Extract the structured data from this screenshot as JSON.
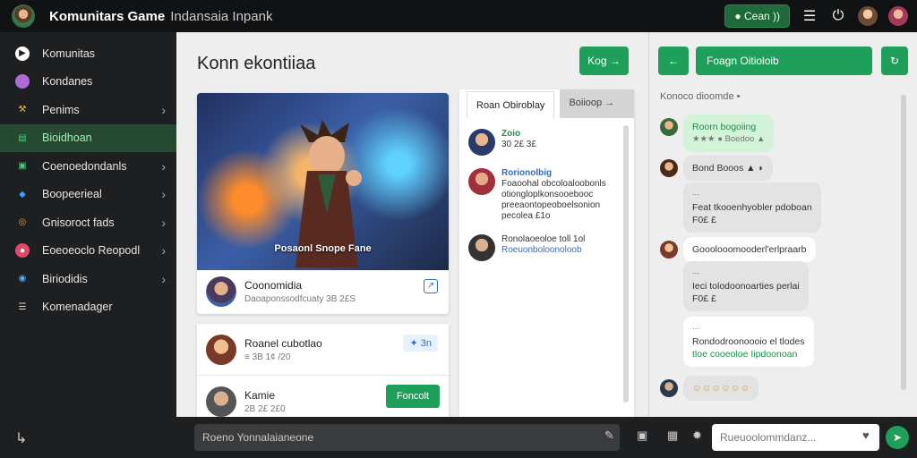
{
  "app": {
    "title": "Komunitars Game",
    "subtitle": "Indansaia Inpank"
  },
  "topbar": {
    "online_label": "● Cean )) ",
    "menu_icon": "☰",
    "power_icon": "⏻"
  },
  "sidebar": {
    "items": [
      {
        "label": "Komunitas",
        "icon": "play-icon",
        "glyph": "▶",
        "bg": "#ffffff",
        "fg": "#1e1f21",
        "chevron": false,
        "active": false
      },
      {
        "label": "Kondanes",
        "icon": "avatar-icon",
        "glyph": "",
        "bg": "#b06ad8",
        "fg": "#fff",
        "chevron": false,
        "active": false
      },
      {
        "label": "Penims",
        "icon": "trophy-icon",
        "glyph": "⚒",
        "bg": "transparent",
        "fg": "#e0c060",
        "chevron": true,
        "active": false
      },
      {
        "label": "Bioidhoan",
        "icon": "chart-icon",
        "glyph": "▤",
        "bg": "transparent",
        "fg": "#3fd07a",
        "chevron": false,
        "active": true
      },
      {
        "label": "Coenoedondanls",
        "icon": "group-icon",
        "glyph": "▣",
        "bg": "transparent",
        "fg": "#3fd07a",
        "chevron": true,
        "active": false
      },
      {
        "label": "Boopeerieal",
        "icon": "puzzle-icon",
        "glyph": "◆",
        "bg": "transparent",
        "fg": "#3aa0ff",
        "chevron": true,
        "active": false
      },
      {
        "label": "Gnisoroct fads",
        "icon": "coin-icon",
        "glyph": "◎",
        "bg": "transparent",
        "fg": "#f0a030",
        "chevron": true,
        "active": false
      },
      {
        "label": "Eoeoeoclo Reopodl",
        "icon": "game-icon",
        "glyph": "●",
        "bg": "#e04a6a",
        "fg": "#fff",
        "chevron": true,
        "active": false
      },
      {
        "label": "Biriodidis",
        "icon": "globe-icon",
        "glyph": "◉",
        "bg": "transparent",
        "fg": "#5ab0ff",
        "chevron": true,
        "active": false
      },
      {
        "label": "Komenadager",
        "icon": "chat-icon",
        "glyph": "☰",
        "bg": "transparent",
        "fg": "#ddd",
        "chevron": false,
        "active": false
      }
    ]
  },
  "main": {
    "title": "Konn ekontiiaa",
    "action_button": "Kog →",
    "feature": {
      "caption": "Posaonl Snope Fane",
      "name": "Coonomidia",
      "sub": "Daoaponssodfcuaty 3B 2£S"
    },
    "posts": [
      {
        "name": "Roanel cubotlao",
        "sub": "≡ 3B 1¢ /20",
        "badge": "✦ 3n"
      },
      {
        "name": "Kamie",
        "sub": "2B 2£ 2£0",
        "button": "Foncolt"
      }
    ]
  },
  "list_panel": {
    "tabs": [
      "Roan Obiroblay",
      "Boiioop →"
    ],
    "items": [
      {
        "name": "Zoio",
        "lines": [
          "30 2£ 3£"
        ]
      },
      {
        "name": "Rorionolbig",
        "lines": [
          "Foaoohal obcoloaloobonls",
          "otiongloplkonsooebooc",
          "preeaontopeoboelsonion",
          "pecolea £1o"
        ]
      },
      {
        "name": "",
        "lines": [
          "Ronolaoeoloe toll 1ol",
          "Roeuonboloonoloob"
        ]
      }
    ]
  },
  "chat": {
    "header_button": "Foagn Oitioloib",
    "subtitle": "Konoco dioomde •",
    "messages": [
      {
        "text": "Roorn bogoiing",
        "sub": "★★★ ● Boedoo ▲",
        "style": "green"
      },
      {
        "text": "Bond Booos ▲ ◗",
        "sub": "",
        "style": "grey"
      },
      {
        "text": "Feat tkooenhyobler pdoboan",
        "sub": "F0£ £",
        "style": "grey"
      },
      {
        "text": "Gooolooomooderl'erlpraarb",
        "sub": "",
        "style": "white"
      },
      {
        "text": "Ieci tolodoonoarties perlai",
        "sub": "F0£ £",
        "style": "grey"
      },
      {
        "text": "Rondodroonoooio el tlodes",
        "sub": "tloe cooeoloe Iipdoonoan",
        "style": "white"
      },
      {
        "text": "☺☺☺☺☺☺",
        "sub": "",
        "style": "grey"
      }
    ]
  },
  "bottombar": {
    "compose_placeholder": "Roeno Yonnalaianeone",
    "chat_placeholder": "Rueuoolommdanz..."
  }
}
